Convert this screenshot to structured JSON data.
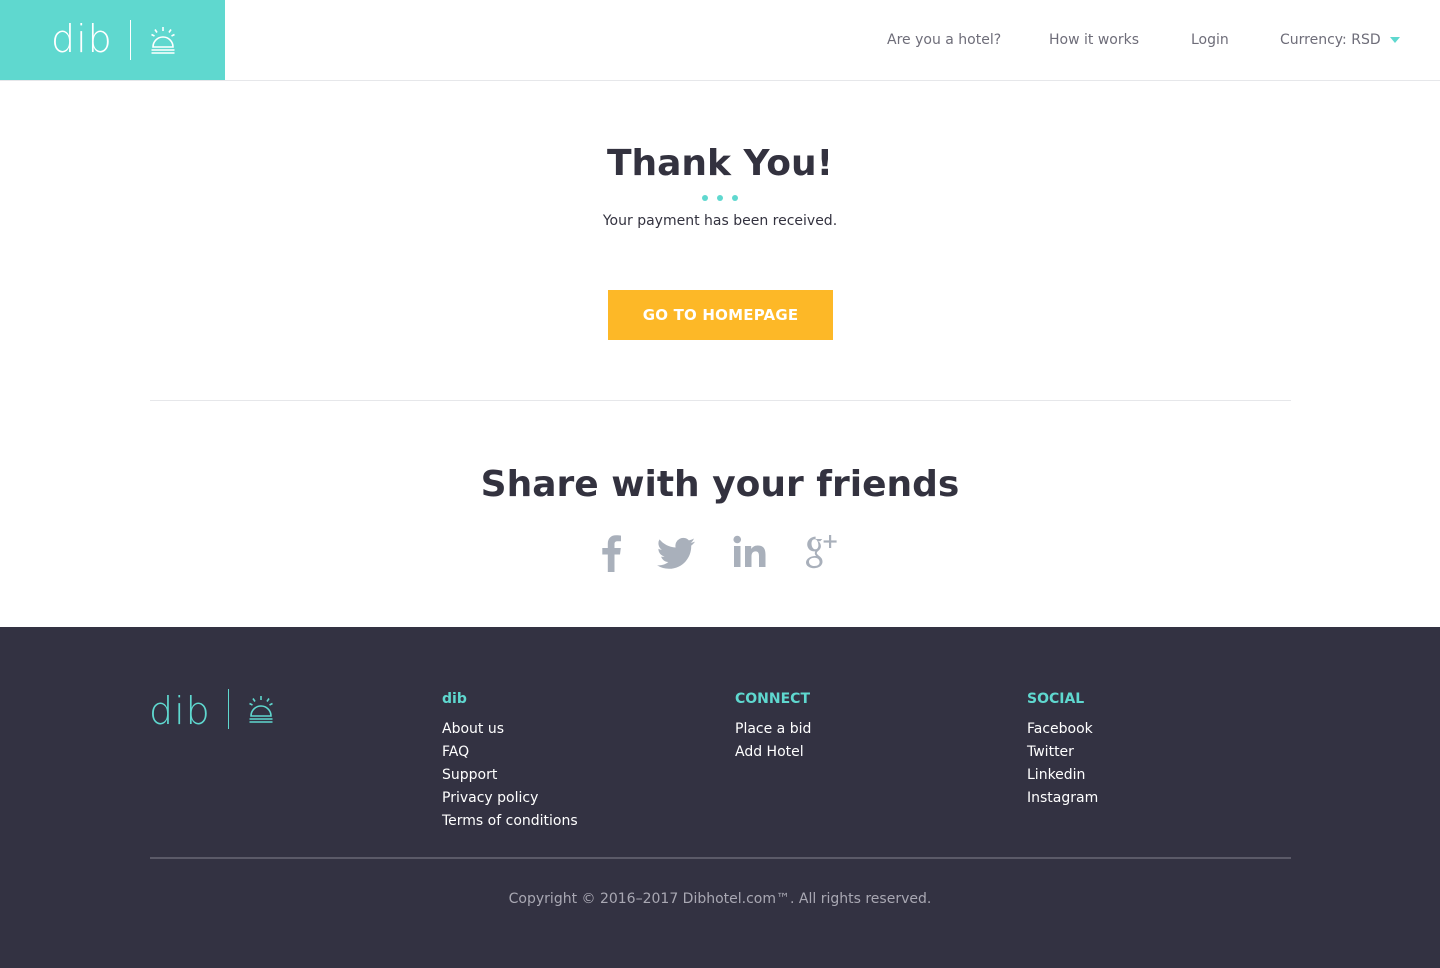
{
  "header": {
    "logo_text": "dib",
    "nav": {
      "hotel": "Are you a hotel?",
      "how": "How it works",
      "login": "Login",
      "currency": "Currency: RSD"
    }
  },
  "main": {
    "title": "Thank You!",
    "subtitle": "Your payment has been received.",
    "cta_label": "GO TO HOMEPAGE"
  },
  "share": {
    "title": "Share with your friends",
    "icons": [
      "facebook-icon",
      "twitter-icon",
      "linkedin-icon",
      "google-plus-icon"
    ]
  },
  "footer": {
    "logo_text": "dib",
    "columns": [
      {
        "heading": "dib",
        "links": [
          "About us",
          "FAQ",
          "Support",
          "Privacy policy",
          "Terms of conditions"
        ]
      },
      {
        "heading": "CONNECT",
        "links": [
          "Place a bid",
          "Add Hotel"
        ]
      },
      {
        "heading": "SOCIAL",
        "links": [
          "Facebook",
          "Twitter",
          "Linkedin",
          "Instagram"
        ]
      }
    ],
    "copyright": "Copyright © 2016–2017 Dibhotel.com™. All rights reserved."
  },
  "colors": {
    "accent": "#5fd8cf",
    "cta": "#fdb827",
    "text_dark": "#33323f",
    "footer_bg": "#333242",
    "icon_gray": "#a9b0bb"
  }
}
